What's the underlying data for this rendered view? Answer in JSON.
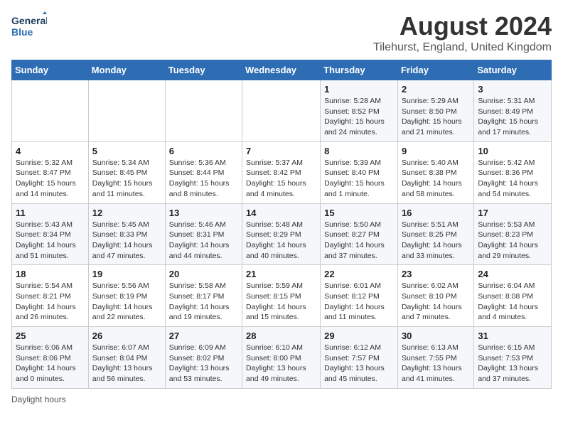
{
  "logo": {
    "line1": "General",
    "line2": "Blue"
  },
  "title": "August 2024",
  "subtitle": "Tilehurst, England, United Kingdom",
  "days_of_week": [
    "Sunday",
    "Monday",
    "Tuesday",
    "Wednesday",
    "Thursday",
    "Friday",
    "Saturday"
  ],
  "footer": "Daylight hours",
  "weeks": [
    [
      {
        "day": "",
        "info": ""
      },
      {
        "day": "",
        "info": ""
      },
      {
        "day": "",
        "info": ""
      },
      {
        "day": "",
        "info": ""
      },
      {
        "day": "1",
        "info": "Sunrise: 5:28 AM\nSunset: 8:52 PM\nDaylight: 15 hours and 24 minutes."
      },
      {
        "day": "2",
        "info": "Sunrise: 5:29 AM\nSunset: 8:50 PM\nDaylight: 15 hours and 21 minutes."
      },
      {
        "day": "3",
        "info": "Sunrise: 5:31 AM\nSunset: 8:49 PM\nDaylight: 15 hours and 17 minutes."
      }
    ],
    [
      {
        "day": "4",
        "info": "Sunrise: 5:32 AM\nSunset: 8:47 PM\nDaylight: 15 hours and 14 minutes."
      },
      {
        "day": "5",
        "info": "Sunrise: 5:34 AM\nSunset: 8:45 PM\nDaylight: 15 hours and 11 minutes."
      },
      {
        "day": "6",
        "info": "Sunrise: 5:36 AM\nSunset: 8:44 PM\nDaylight: 15 hours and 8 minutes."
      },
      {
        "day": "7",
        "info": "Sunrise: 5:37 AM\nSunset: 8:42 PM\nDaylight: 15 hours and 4 minutes."
      },
      {
        "day": "8",
        "info": "Sunrise: 5:39 AM\nSunset: 8:40 PM\nDaylight: 15 hours and 1 minute."
      },
      {
        "day": "9",
        "info": "Sunrise: 5:40 AM\nSunset: 8:38 PM\nDaylight: 14 hours and 58 minutes."
      },
      {
        "day": "10",
        "info": "Sunrise: 5:42 AM\nSunset: 8:36 PM\nDaylight: 14 hours and 54 minutes."
      }
    ],
    [
      {
        "day": "11",
        "info": "Sunrise: 5:43 AM\nSunset: 8:34 PM\nDaylight: 14 hours and 51 minutes."
      },
      {
        "day": "12",
        "info": "Sunrise: 5:45 AM\nSunset: 8:33 PM\nDaylight: 14 hours and 47 minutes."
      },
      {
        "day": "13",
        "info": "Sunrise: 5:46 AM\nSunset: 8:31 PM\nDaylight: 14 hours and 44 minutes."
      },
      {
        "day": "14",
        "info": "Sunrise: 5:48 AM\nSunset: 8:29 PM\nDaylight: 14 hours and 40 minutes."
      },
      {
        "day": "15",
        "info": "Sunrise: 5:50 AM\nSunset: 8:27 PM\nDaylight: 14 hours and 37 minutes."
      },
      {
        "day": "16",
        "info": "Sunrise: 5:51 AM\nSunset: 8:25 PM\nDaylight: 14 hours and 33 minutes."
      },
      {
        "day": "17",
        "info": "Sunrise: 5:53 AM\nSunset: 8:23 PM\nDaylight: 14 hours and 29 minutes."
      }
    ],
    [
      {
        "day": "18",
        "info": "Sunrise: 5:54 AM\nSunset: 8:21 PM\nDaylight: 14 hours and 26 minutes."
      },
      {
        "day": "19",
        "info": "Sunrise: 5:56 AM\nSunset: 8:19 PM\nDaylight: 14 hours and 22 minutes."
      },
      {
        "day": "20",
        "info": "Sunrise: 5:58 AM\nSunset: 8:17 PM\nDaylight: 14 hours and 19 minutes."
      },
      {
        "day": "21",
        "info": "Sunrise: 5:59 AM\nSunset: 8:15 PM\nDaylight: 14 hours and 15 minutes."
      },
      {
        "day": "22",
        "info": "Sunrise: 6:01 AM\nSunset: 8:12 PM\nDaylight: 14 hours and 11 minutes."
      },
      {
        "day": "23",
        "info": "Sunrise: 6:02 AM\nSunset: 8:10 PM\nDaylight: 14 hours and 7 minutes."
      },
      {
        "day": "24",
        "info": "Sunrise: 6:04 AM\nSunset: 8:08 PM\nDaylight: 14 hours and 4 minutes."
      }
    ],
    [
      {
        "day": "25",
        "info": "Sunrise: 6:06 AM\nSunset: 8:06 PM\nDaylight: 14 hours and 0 minutes."
      },
      {
        "day": "26",
        "info": "Sunrise: 6:07 AM\nSunset: 8:04 PM\nDaylight: 13 hours and 56 minutes."
      },
      {
        "day": "27",
        "info": "Sunrise: 6:09 AM\nSunset: 8:02 PM\nDaylight: 13 hours and 53 minutes."
      },
      {
        "day": "28",
        "info": "Sunrise: 6:10 AM\nSunset: 8:00 PM\nDaylight: 13 hours and 49 minutes."
      },
      {
        "day": "29",
        "info": "Sunrise: 6:12 AM\nSunset: 7:57 PM\nDaylight: 13 hours and 45 minutes."
      },
      {
        "day": "30",
        "info": "Sunrise: 6:13 AM\nSunset: 7:55 PM\nDaylight: 13 hours and 41 minutes."
      },
      {
        "day": "31",
        "info": "Sunrise: 6:15 AM\nSunset: 7:53 PM\nDaylight: 13 hours and 37 minutes."
      }
    ]
  ]
}
